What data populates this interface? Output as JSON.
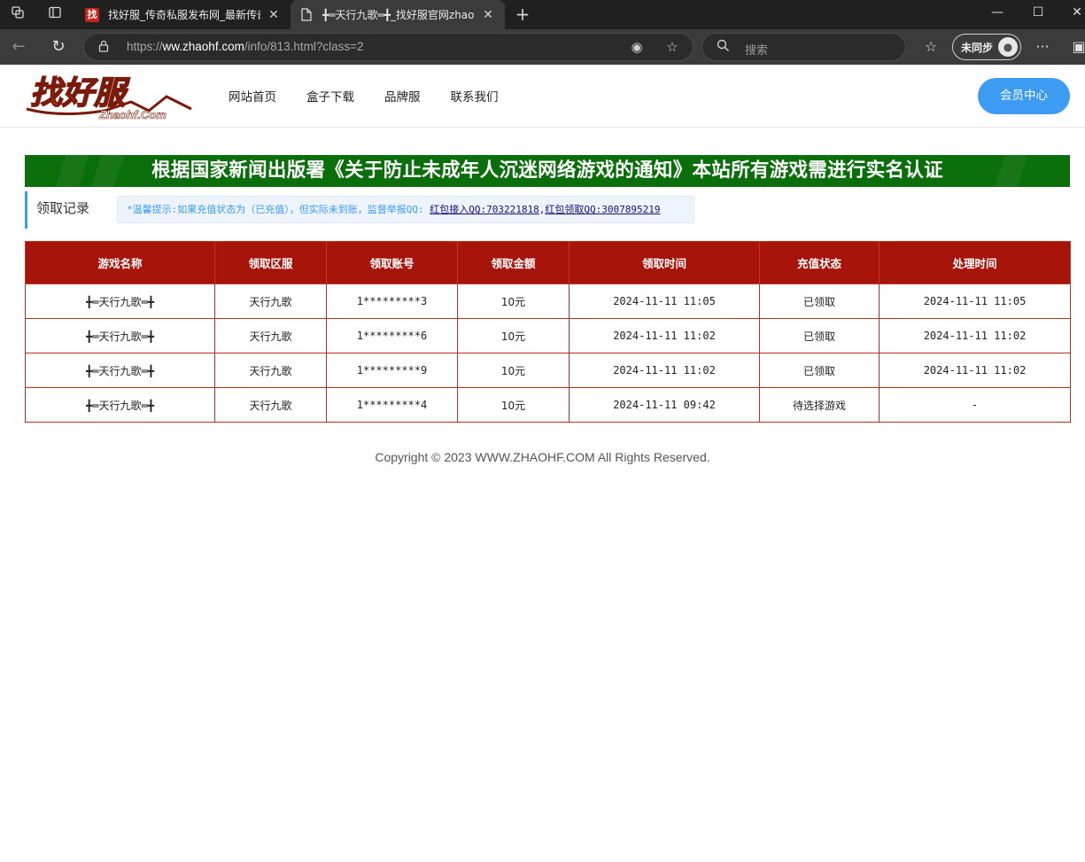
{
  "browser": {
    "tabs": [
      {
        "title": "找好服_传奇私服发布网_最新传奇私服",
        "favicon": "找",
        "active": false
      },
      {
        "title": "╋═天行九歌═╋_找好服官网zhaohf.com",
        "active": true
      }
    ],
    "url_scheme": "https://",
    "url_host": "ww.zhaohf.com",
    "url_path": "/info/813.html?class=2",
    "search_placeholder": "搜索",
    "profile_label": "未同步"
  },
  "site": {
    "logo_text": "找好服",
    "logo_sub": "Zhaohf.Com",
    "nav": [
      "网站首页",
      "盒子下载",
      "品牌服",
      "联系我们"
    ],
    "member_button": "会员中心",
    "notice": "根据国家新闻出版署《关于防止未成年人沉迷网络游戏的通知》本站所有游戏需进行实名认证",
    "section_title": "领取记录",
    "tip": {
      "text": "*温馨提示:如果充值状态为（已充值），但实际未到账，监督举报QQ:",
      "link1": "红包接入QQ:703221818",
      "separator": ",",
      "link2": "红包领取QQ:3007895219"
    },
    "table": {
      "headers": [
        "游戏名称",
        "领取区服",
        "领取账号",
        "领取金额",
        "领取时间",
        "充值状态",
        "处理时间"
      ],
      "rows": [
        [
          "╋═天行九歌═╋",
          "天行九歌",
          "1*********3",
          "10元",
          "2024-11-11 11:05",
          "已领取",
          "2024-11-11 11:05"
        ],
        [
          "╋═天行九歌═╋",
          "天行九歌",
          "1*********6",
          "10元",
          "2024-11-11 11:02",
          "已领取",
          "2024-11-11 11:02"
        ],
        [
          "╋═天行九歌═╋",
          "天行九歌",
          "1*********9",
          "10元",
          "2024-11-11 11:02",
          "已领取",
          "2024-11-11 11:02"
        ],
        [
          "╋═天行九歌═╋",
          "天行九歌",
          "1*********4",
          "10元",
          "2024-11-11 09:42",
          "待选择游戏",
          "-"
        ]
      ]
    },
    "copyright": "Copyright © 2023 WWW.ZHAOHF.COM All Rights Reserved."
  },
  "colors": {
    "table_header": "#a6140a",
    "notice_bg": "#0a6e0a",
    "accent_blue": "#3d9bf2",
    "chrome_dark": "#202020"
  }
}
